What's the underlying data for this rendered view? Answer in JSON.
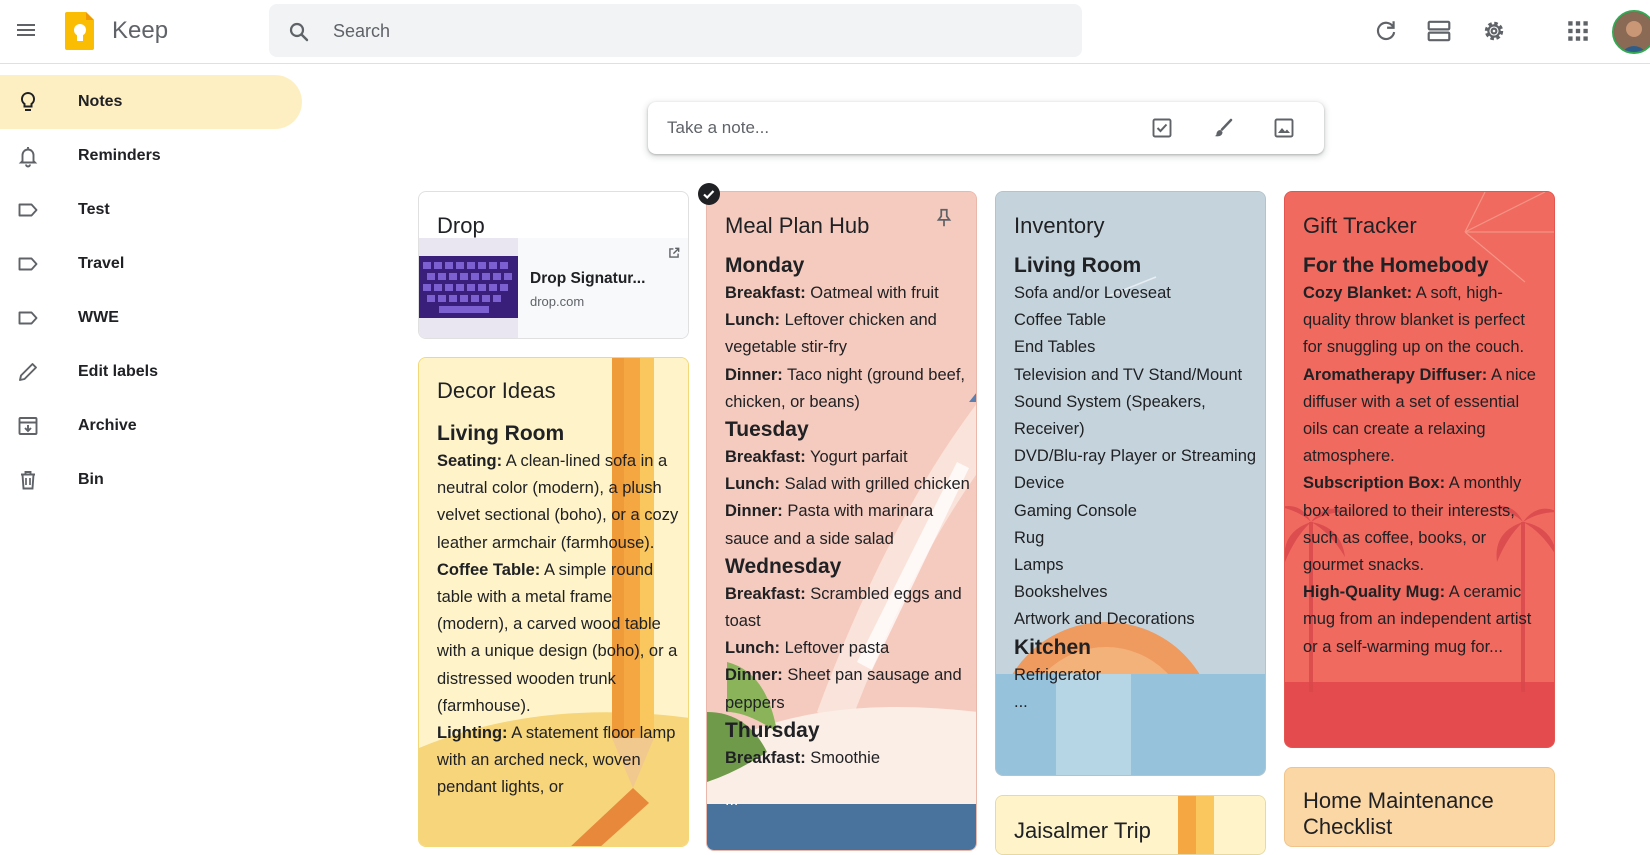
{
  "app": {
    "title": "Keep"
  },
  "search": {
    "placeholder": "Search"
  },
  "header_icons": [
    "refresh-icon",
    "list-view-icon",
    "settings-icon",
    "apps-icon"
  ],
  "sidebar": {
    "items": [
      {
        "label": "Notes",
        "icon": "lightbulb-icon",
        "active": true
      },
      {
        "label": "Reminders",
        "icon": "bell-icon"
      },
      {
        "label": "Test",
        "icon": "label-icon"
      },
      {
        "label": "Travel",
        "icon": "label-icon"
      },
      {
        "label": "WWE",
        "icon": "label-icon"
      },
      {
        "label": "Edit labels",
        "icon": "pencil-icon"
      },
      {
        "label": "Archive",
        "icon": "archive-icon"
      },
      {
        "label": "Bin",
        "icon": "trash-icon"
      }
    ]
  },
  "take_note": {
    "placeholder": "Take a note..."
  },
  "notes": {
    "drop": {
      "title": "Drop",
      "link_title": "Drop Signatur...",
      "link_domain": "drop.com"
    },
    "decor": {
      "title": "Decor Ideas",
      "heading": "Living Room",
      "p1_label": "Seating:",
      "p1_text": " A clean-lined sofa in a neutral color (modern), a plush velvet sectional (boho), or a cozy leather armchair (farmhouse).",
      "p2_label": "Coffee Table:",
      "p2_text": " A simple round table with a metal frame (modern), a carved wood table with a unique design (boho), or a distressed wooden trunk (farmhouse).",
      "p3_label": "Lighting:",
      "p3_text": " A statement floor lamp with an arched neck, woven pendant lights, or",
      "color": "#fff8b8"
    },
    "meal": {
      "title": "Meal Plan Hub",
      "days": [
        {
          "day": "Monday",
          "rows": [
            {
              "label": "Breakfast:",
              "text": " Oatmeal with fruit"
            },
            {
              "label": "Lunch:",
              "text": " Leftover chicken and vegetable stir-fry"
            },
            {
              "label": "Dinner:",
              "text": " Taco night (ground beef, chicken, or beans)"
            }
          ]
        },
        {
          "day": "Tuesday",
          "rows": [
            {
              "label": "Breakfast:",
              "text": " Yogurt parfait"
            },
            {
              "label": "Lunch:",
              "text": " Salad with grilled chicken"
            },
            {
              "label": "Dinner:",
              "text": " Pasta with marinara sauce and a side salad"
            }
          ]
        },
        {
          "day": "Wednesday",
          "rows": [
            {
              "label": "Breakfast:",
              "text": " Scrambled eggs and toast"
            },
            {
              "label": "Lunch:",
              "text": " Leftover pasta"
            },
            {
              "label": "Dinner:",
              "text": " Sheet pan sausage and peppers"
            }
          ]
        },
        {
          "day": "Thursday",
          "rows": [
            {
              "label": "Breakfast:",
              "text": " Smoothie"
            }
          ]
        }
      ],
      "more": "...",
      "color": "#f6cfc4"
    },
    "inventory": {
      "title": "Inventory",
      "heading1": "Living Room",
      "items": [
        "Sofa and/or Loveseat",
        "Coffee Table",
        "End Tables",
        "Television and TV Stand/Mount",
        "Sound System (Speakers, Receiver)",
        "DVD/Blu-ray Player or Streaming Device",
        "Gaming Console",
        "Rug",
        "Lamps",
        "Bookshelves",
        "Artwork and Decorations"
      ],
      "heading2": "Kitchen",
      "items2": [
        "Refrigerator"
      ],
      "more": "...",
      "color": "#c5d4dc"
    },
    "gift": {
      "title": "Gift Tracker",
      "heading": "For the Homebody",
      "entries": [
        {
          "label": "Cozy Blanket:",
          "text": " A soft, high-quality throw blanket is perfect for snuggling up on the couch."
        },
        {
          "label": "Aromatherapy Diffuser:",
          "text": " A nice diffuser with a set of essential oils can create a relaxing atmosphere."
        },
        {
          "label": "Subscription Box:",
          "text": " A monthly box tailored to their interests, such as coffee, books, or gourmet snacks."
        },
        {
          "label": "High-Quality Mug:",
          "text": " A ceramic mug from an independent artist or a self-warming mug for..."
        }
      ],
      "color": "#f0625c"
    },
    "jaisalmer": {
      "title": "Jaisalmer Trip"
    },
    "home": {
      "title": "Home Maintenance Checklist"
    }
  }
}
